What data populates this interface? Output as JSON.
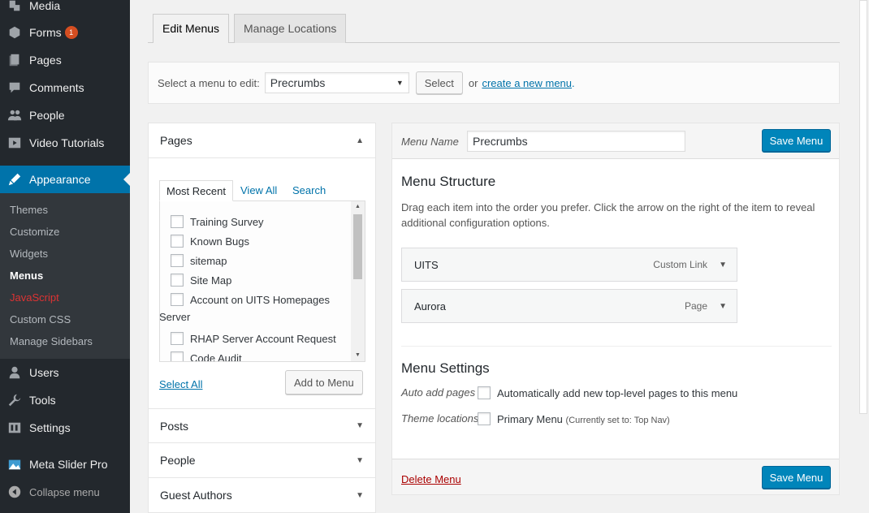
{
  "sidebar": {
    "items": [
      {
        "label": "Media",
        "icon": "media-icon"
      },
      {
        "label": "Forms",
        "icon": "forms-icon",
        "badge": "1"
      },
      {
        "label": "Pages",
        "icon": "pages-icon"
      },
      {
        "label": "Comments",
        "icon": "comments-icon"
      },
      {
        "label": "People",
        "icon": "people-icon"
      },
      {
        "label": "Video Tutorials",
        "icon": "video-icon"
      },
      {
        "label": "Appearance",
        "icon": "appearance-icon"
      },
      {
        "label": "Users",
        "icon": "users-icon"
      },
      {
        "label": "Tools",
        "icon": "tools-icon"
      },
      {
        "label": "Settings",
        "icon": "settings-icon"
      },
      {
        "label": "Meta Slider Pro",
        "icon": "meta-slider-icon"
      }
    ],
    "submenu": [
      "Themes",
      "Customize",
      "Widgets",
      "Menus",
      "JavaScript",
      "Custom CSS",
      "Manage Sidebars"
    ],
    "collapse_label": "Collapse menu"
  },
  "tabs": {
    "edit": "Edit Menus",
    "manage": "Manage Locations"
  },
  "select_bar": {
    "label": "Select a menu to edit:",
    "selected": "Precrumbs",
    "button": "Select",
    "or": "or",
    "create_link": "create a new menu",
    "period": "."
  },
  "left": {
    "pages_title": "Pages",
    "inner_tabs": [
      "Most Recent",
      "View All",
      "Search"
    ],
    "page_items": [
      "Training Survey",
      "Known Bugs",
      "sitemap",
      "Site Map",
      "Account on UITS Homepages",
      "Server",
      "RHAP Server Account Request",
      "Code Audit"
    ],
    "select_all": "Select All",
    "add_button": "Add to Menu",
    "sections": [
      "Posts",
      "People",
      "Guest Authors"
    ]
  },
  "right": {
    "menu_name_label": "Menu Name",
    "menu_name_value": "Precrumbs",
    "save_label": "Save Menu",
    "structure_title": "Menu Structure",
    "structure_help": "Drag each item into the order you prefer. Click the arrow on the right of the item to reveal additional configuration options.",
    "menu_items": [
      {
        "title": "UITS",
        "type": "Custom Link"
      },
      {
        "title": "Aurora",
        "type": "Page"
      }
    ],
    "settings_title": "Menu Settings",
    "auto_add_label": "Auto add pages",
    "auto_add_text": "Automatically add new top-level pages to this menu",
    "theme_locations_label": "Theme locations",
    "primary_menu_text": "Primary Menu",
    "primary_menu_note": "(Currently set to: Top Nav)",
    "delete_label": "Delete Menu"
  },
  "colors": {
    "sidebar_bg": "#23282d",
    "active_blue": "#0073aa",
    "primary_button": "#0085ba",
    "badge": "#d54e21",
    "delete_red": "#a00"
  }
}
